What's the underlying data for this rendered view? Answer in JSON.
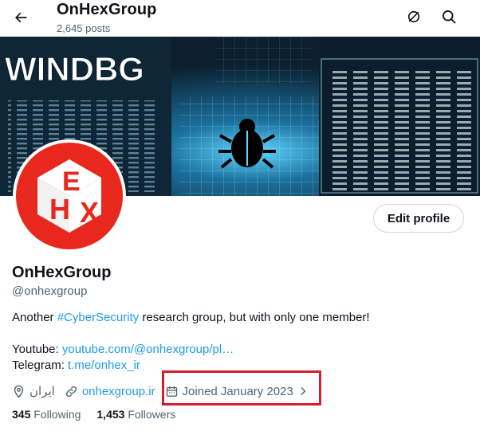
{
  "header": {
    "title": "OnHexGroup",
    "post_count": "2,645 posts"
  },
  "banner": {
    "text": "WINDBG"
  },
  "avatar": {
    "letters": [
      "H",
      "E",
      "X"
    ]
  },
  "actions": {
    "edit_profile": "Edit profile"
  },
  "profile": {
    "name": "OnHexGroup",
    "handle": "@onhexgroup",
    "bio_prefix": "Another ",
    "bio_hashtag": "#CyberSecurity",
    "bio_suffix": " research group, but with only one member!",
    "youtube_label": "Youtube:",
    "youtube_link": "youtube.com/@onhexgroup/pl…",
    "telegram_label": "Telegram:",
    "telegram_link": "t.me/onhex_ir",
    "location": "ایران",
    "website": "onhexgroup.ir",
    "joined": "Joined January 2023"
  },
  "stats": {
    "following_count": "345",
    "following_label": "Following",
    "followers_count": "1,453",
    "followers_label": "Followers"
  },
  "colors": {
    "accent": "#1d9bf0",
    "highlight_box": "#d21f2b",
    "avatar_red": "#e8281c"
  }
}
